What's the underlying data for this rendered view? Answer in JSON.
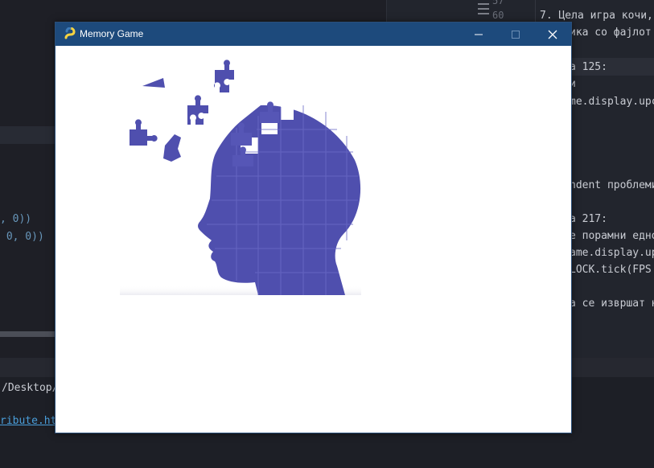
{
  "background_ide": {
    "left_code": [
      {
        "text": ", 0))"
      },
      {
        "text": " 0, 0))"
      }
    ],
    "gutter_numbers": [
      "57",
      "60"
    ],
    "right_notes": [
      "7. Цела игра кочи,",
      "ика со фајлот",
      "а 125:",
      "и",
      "me.display.upc",
      "ndent проблеми",
      "а 217:",
      "е порамни едно",
      "ame.display.up",
      "LOCK.tick(FPS",
      "а се извршат н"
    ],
    "terminal": {
      "path": "/Desktop/",
      "link": "ribute.ht"
    }
  },
  "window": {
    "title": "Memory Game",
    "icon": "pygame-snake-icon",
    "controls": {
      "minimize": "minimize-icon",
      "maximize": "maximize-icon",
      "close": "close-icon"
    }
  },
  "canvas": {
    "image": "head-puzzle-illustration",
    "colors": {
      "puzzle": "#4f4fae",
      "puzzle_light": "#6262c2",
      "titlebar": "#1d4a7c"
    }
  }
}
